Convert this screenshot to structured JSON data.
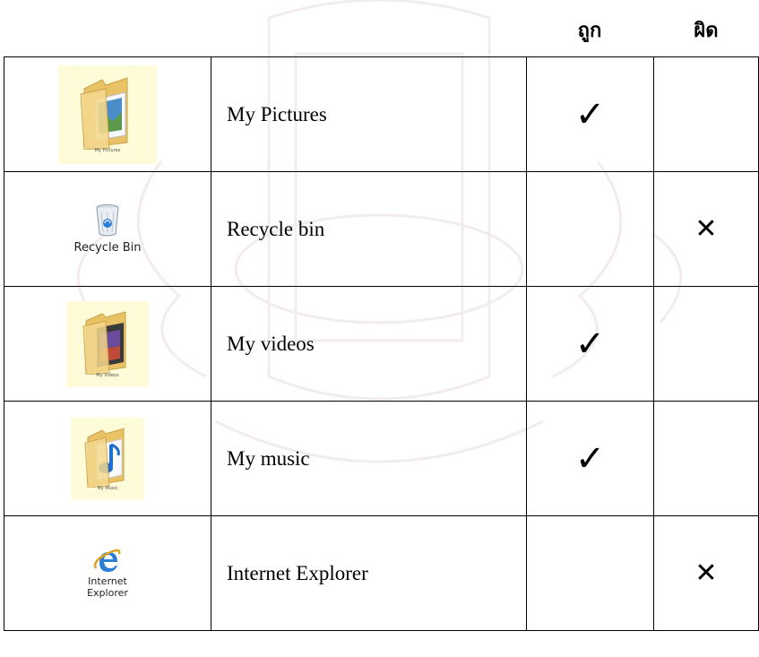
{
  "header": {
    "correct_label": "ถูก",
    "wrong_label": "ผิด"
  },
  "rows": [
    {
      "icon": "my-pictures-folder-icon",
      "icon_caption": "My Pictures",
      "name": "My Pictures",
      "correct": "✓",
      "wrong": ""
    },
    {
      "icon": "recycle-bin-icon",
      "icon_caption": "Recycle Bin",
      "name": "Recycle bin",
      "correct": "",
      "wrong": "✕"
    },
    {
      "icon": "my-videos-folder-icon",
      "icon_caption": "My Videos",
      "name": "My videos",
      "correct": "✓",
      "wrong": ""
    },
    {
      "icon": "my-music-folder-icon",
      "icon_caption": "My Music",
      "name": "My music",
      "correct": "✓",
      "wrong": ""
    },
    {
      "icon": "internet-explorer-icon",
      "icon_caption_line1": "Internet",
      "icon_caption_line2": "Explorer",
      "name": "Internet Explorer",
      "correct": "",
      "wrong": "✕"
    }
  ],
  "colors": {
    "folder_yellow": "#f2d27a",
    "icon_background": "#fdfbd8",
    "ie_blue": "#2a7fd4"
  }
}
